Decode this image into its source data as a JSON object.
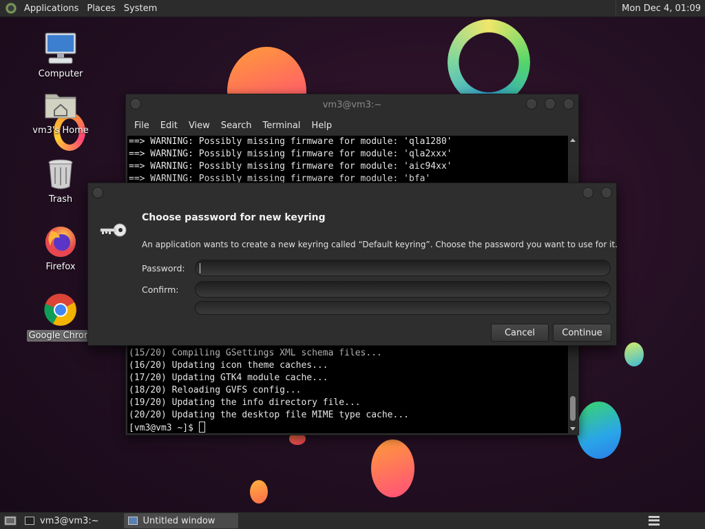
{
  "top_panel": {
    "menus": [
      "Applications",
      "Places",
      "System"
    ],
    "clock": "Mon Dec 4, 01:09"
  },
  "desktop_icons": [
    {
      "label": "Computer",
      "icon": "computer-icon"
    },
    {
      "label": "vm3's Home",
      "icon": "home-folder-icon"
    },
    {
      "label": "Trash",
      "icon": "trash-icon"
    },
    {
      "label": "Firefox",
      "icon": "firefox-icon"
    },
    {
      "label": "Google Chrom",
      "icon": "chrome-icon",
      "selected": true
    }
  ],
  "terminal": {
    "title": "vm3@vm3:~",
    "menus": [
      "File",
      "Edit",
      "View",
      "Search",
      "Terminal",
      "Help"
    ],
    "lines_top": [
      "==> WARNING: Possibly missing firmware for module: 'qla1280'",
      "==> WARNING: Possibly missing firmware for module: 'qla2xxx'",
      "==> WARNING: Possibly missing firmware for module: 'aic94xx'",
      "==> WARNING: Possibly missing firmware for module: 'bfa'"
    ],
    "lines_bottom": [
      "(15/20) Compiling GSettings XML schema files...",
      "(16/20) Updating icon theme caches...",
      "(17/20) Updating GTK4 module cache...",
      "(18/20) Reloading GVFS config...",
      "(19/20) Updating the info directory file...",
      "(20/20) Updating the desktop file MIME type cache..."
    ],
    "prompt": "[vm3@vm3 ~]$ "
  },
  "dialog": {
    "icon": "key-icon",
    "heading": "Choose password for new keyring",
    "description": "An application wants to create a new keyring called “Default keyring”. Choose the password you want to use for it.",
    "password_label": "Password:",
    "password_value": "",
    "confirm_label": "Confirm:",
    "confirm_value": "",
    "cancel_label": "Cancel",
    "continue_label": "Continue"
  },
  "taskbar": {
    "tasks": [
      {
        "label": "vm3@vm3:~",
        "icon": "terminal-icon",
        "active": false
      },
      {
        "label": "Untitled window",
        "icon": "window-icon",
        "active": true
      }
    ]
  }
}
